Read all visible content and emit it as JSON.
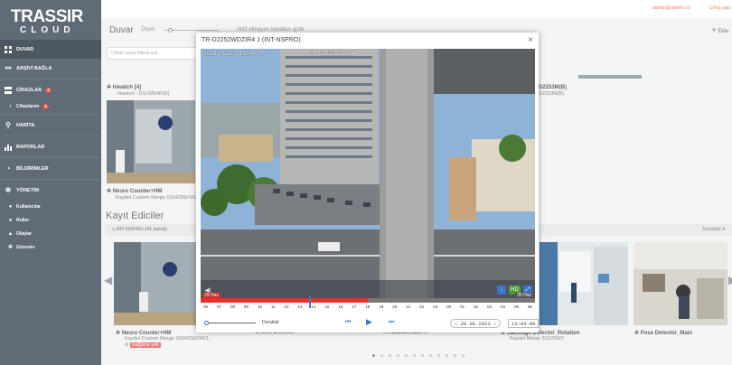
{
  "brand": {
    "main": "TRASSIR",
    "sub": "CLOUD"
  },
  "sidebar": {
    "items": [
      {
        "label": "DUVAR",
        "icon": "grid-icon",
        "active": true
      },
      {
        "label": "ARŞİVİ BAĞLA",
        "icon": "link-icon"
      },
      {
        "label": "CİHAZLAR",
        "icon": "server-icon",
        "badge": "4"
      },
      {
        "label": "Cihazlarım",
        "icon": "folder-icon",
        "badge": "4",
        "sub": true
      },
      {
        "label": "HARİTA",
        "icon": "map-pin-icon"
      },
      {
        "label": "RAPORLAR",
        "icon": "chart-icon"
      },
      {
        "label": "BİLDİRİMLER",
        "icon": "bell-icon"
      },
      {
        "label": "YÖNETİM",
        "icon": "gear-icon"
      },
      {
        "label": "Kullanıcılar",
        "icon": "users-icon",
        "sub": true
      },
      {
        "label": "Roller",
        "icon": "key-icon",
        "sub": true
      },
      {
        "label": "Olaylar",
        "icon": "bell-icon",
        "sub": true
      },
      {
        "label": "Görevler",
        "icon": "gear-icon",
        "sub": true
      }
    ]
  },
  "topbar": {
    "email": "admin@admin.ru",
    "logout": "Çıkış yap"
  },
  "wall": {
    "title": "Duvar",
    "option_label": "Ölçek",
    "inactive_label": "Aktif olmayan kanalları gizle",
    "add_label": "Ekle",
    "search_placeholder": "Cihaz veya kanal ara",
    "top_cameras": [
      {
        "title": "hiwatch [4]",
        "sub": "hiwatch - DS-N304P(D)"
      },
      {
        "title": "Neuro Counter+HM",
        "sub": "Kaydet Custom Merge 1024/256/0/0/1..."
      },
      {
        "title": "D2253M(B)",
        "sub": "D2253M(B)"
      }
    ]
  },
  "recorders": {
    "title": "Kayıt Ediciler",
    "group": "INT-NSPRO (41 kanal)",
    "right_label": "Genişlet",
    "cameras": [
      {
        "title": "Neuro Counter+HM",
        "sub": "Kaydet Custom Merge 1024/256/0/0/1...",
        "status": "bağlantı yok"
      },
      {
        "title": "Crowd Detector",
        "sub": ""
      },
      {
        "title": "TR-D2252WDZIR4",
        "sub": ""
      },
      {
        "title": "Sabotage Detector_Rotation",
        "sub": "Kaydet Merge 512/256/7"
      },
      {
        "title": "Pose Detector_Main",
        "sub": ""
      }
    ]
  },
  "modal": {
    "title": "TR-D2252WDZIR4 1 (INT-NSPRO)",
    "osd_datetime": "2023-06-29 13:04:00",
    "osd_cam": "TR-D2252WDZIR4",
    "sound_icon": "speaker-icon",
    "hd_label": "HD",
    "timeline": {
      "date_left": "29 Haz",
      "date_right": "30 Haz",
      "labels": [
        "06",
        "07",
        "08",
        "09",
        "10",
        "11",
        "12",
        "13",
        "14",
        "15",
        "16",
        "17",
        "18",
        "19",
        "20",
        "21",
        "22",
        "23",
        "00",
        "01",
        "02",
        "03",
        "04",
        "05",
        "06"
      ]
    },
    "controls": {
      "speed_label": "Duraklat",
      "date_value": "29.06.2023",
      "time_value": "13:04:00"
    }
  },
  "colors": {
    "sidebar": "#5f6b76",
    "accent": "#ff7b56",
    "recording": "#e4332f",
    "control": "#3a74c8"
  }
}
